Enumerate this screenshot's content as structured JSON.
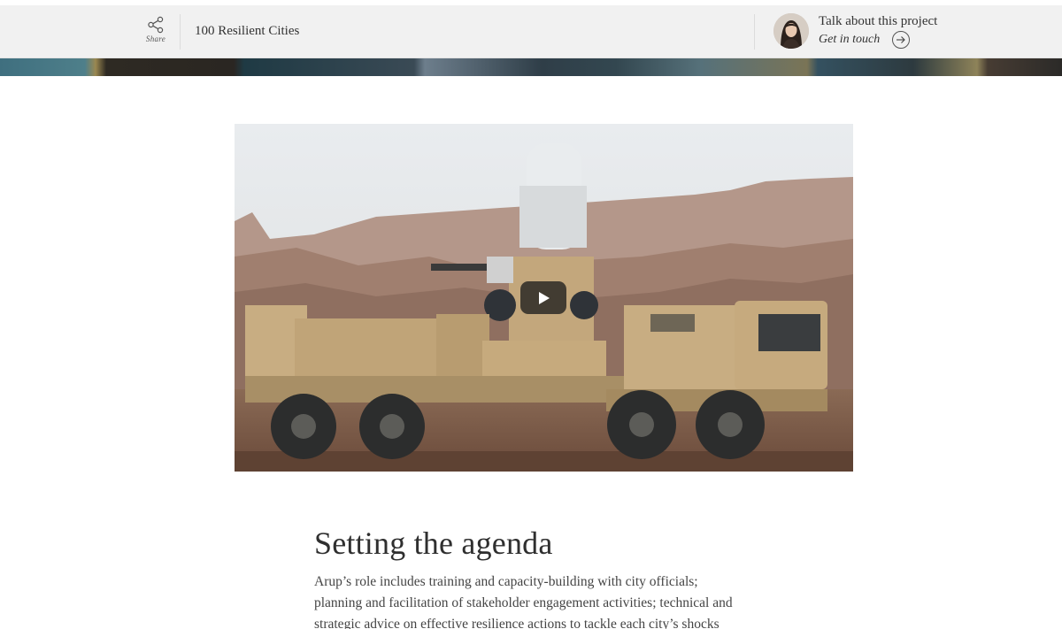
{
  "header": {
    "share_label": "Share",
    "project_title": "100 Resilient Cities",
    "contact_title": "Talk about this project",
    "contact_link": "Get in touch"
  },
  "icons": {
    "share": "share-icon",
    "arrow": "arrow-right-circle-icon",
    "play": "play-icon"
  },
  "article": {
    "heading": "Setting the agenda",
    "body": "Arup’s role includes training and capacity-building with city officials; planning and facilitation of stakeholder engagement activities; technical and strategic advice on effective resilience actions to tackle each city’s shocks"
  },
  "colors": {
    "header_bg": "#f1f1f1",
    "text": "#333333",
    "vehicle_tan": "#c7ad82"
  }
}
